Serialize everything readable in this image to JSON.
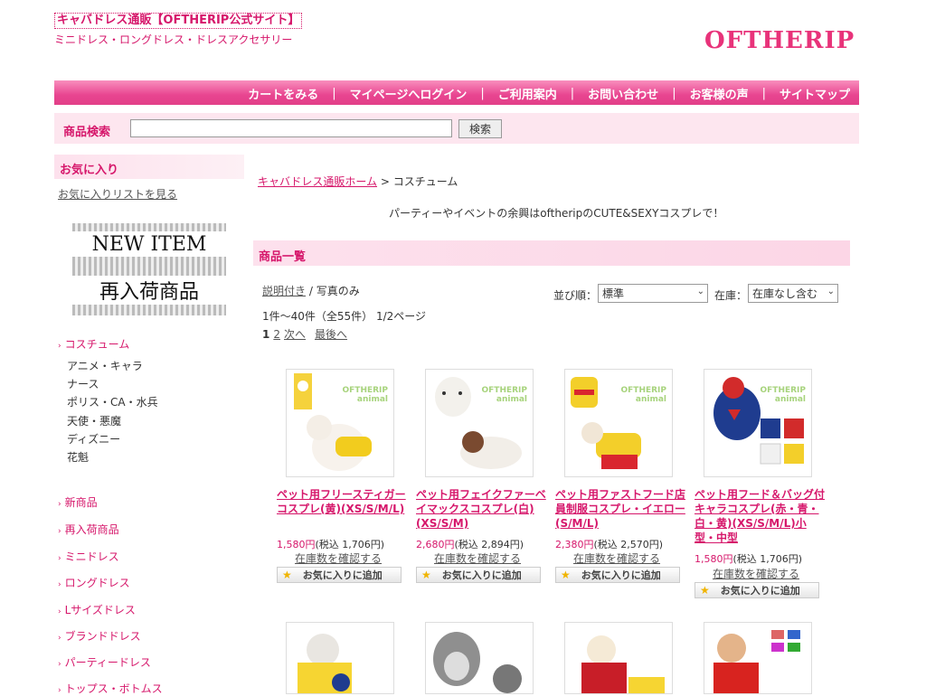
{
  "header": {
    "site_title": "キャバドレス通販【OFTHERIP公式サイト】",
    "subtitle": "ミニドレス・ロングドレス・ドレスアクセサリー",
    "logo": "OFTHERIP"
  },
  "nav": {
    "items": [
      "カートをみる",
      "マイページへログイン",
      "ご利用案内",
      "お問い合わせ",
      "お客様の声",
      "サイトマップ"
    ],
    "separator": "|"
  },
  "search": {
    "label": "商品検索",
    "value": "",
    "button": "検索"
  },
  "sidebar": {
    "favorites_heading": "お気に入り",
    "favorites_link": "お気に入りリストを見る",
    "banner_top": "NEW ITEM",
    "banner_bottom": "再入荷商品",
    "category": "コスチューム",
    "subcategories": [
      "アニメ・キャラ",
      "ナース",
      "ポリス・CA・水兵",
      "天使・悪魔",
      "ディズニー",
      "花魁"
    ],
    "menu": [
      "新商品",
      "再入荷商品",
      "ミニドレス",
      "ロングドレス",
      "Lサイズドレス",
      "ブランドドレス",
      "パーティードレス",
      "トップス・ボトムス"
    ]
  },
  "main": {
    "breadcrumb_home": "キャバドレス通販ホーム",
    "breadcrumb_sep": " > ",
    "breadcrumb_current": "コスチューム",
    "intro": "パーティーやイベントの余興はoftheripのCUTE&SEXYコスプレで！",
    "list_heading": "商品一覧",
    "view_with_desc": "説明付き",
    "view_sep": " / ",
    "view_photo": "写真のみ",
    "count": "1件～40件（全55件） 1/2ページ",
    "pager_current": "1",
    "pager_page2": "2",
    "pager_next": "次へ",
    "pager_last": "最後へ",
    "sort_label": "並び順：",
    "sort_value": "標準",
    "stock_label": "在庫：",
    "stock_value": "在庫なし含む"
  },
  "products": [
    {
      "name": "ペット用フリースティガーコスプレ(黄)(XS/S/M/L)",
      "price": "1,580円",
      "tax": "(税込 1,706円)",
      "stock": "在庫数を確認する",
      "fav": "お気に入りに追加",
      "brand": "OFTHERIP\nanimal"
    },
    {
      "name": "ペット用フェイクファーベイマックスコスプレ(白)(XS/S/M)",
      "price": "2,680円",
      "tax": "(税込 2,894円)",
      "stock": "在庫数を確認する",
      "fav": "お気に入りに追加",
      "brand": "OFTHERIP\nanimal"
    },
    {
      "name": "ペット用ファストフード店員制服コスプレ・イエロー(S/M/L)",
      "price": "2,380円",
      "tax": "(税込 2,570円)",
      "stock": "在庫数を確認する",
      "fav": "お気に入りに追加",
      "brand": "OFTHERIP\nanimal"
    },
    {
      "name": "ペット用フード＆バッグ付キャラコスプレ(赤・青・白・黄)(XS/S/M/L)小型・中型",
      "price": "1,580円",
      "tax": "(税込 1,706円)",
      "stock": "在庫数を確認する",
      "fav": "お気に入りに追加",
      "brand": "OFTHERIP\nanimal"
    }
  ],
  "colors": {
    "accent": "#e8337a",
    "nav_gradient": "#e84590",
    "pale_pink": "#fde6ef"
  }
}
